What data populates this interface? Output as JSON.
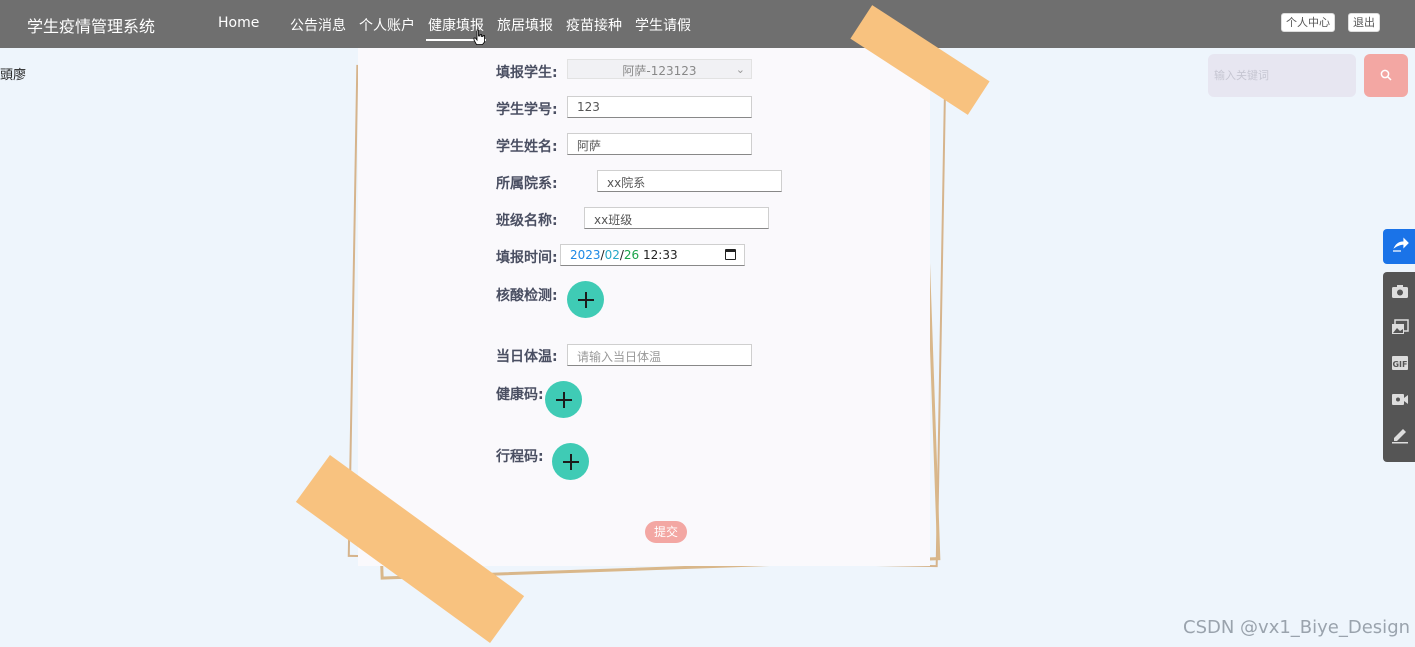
{
  "nav": {
    "brand": "学生疫情管理系统",
    "items": [
      {
        "label": "Home"
      },
      {
        "label": "公告消息"
      },
      {
        "label": "个人账户"
      },
      {
        "label": "健康填报"
      },
      {
        "label": "旅居填报"
      },
      {
        "label": "疫苗接种"
      },
      {
        "label": "学生请假"
      }
    ],
    "active": "健康填报",
    "user_center": "个人中心",
    "logout": "退出"
  },
  "stray_text": "頭廖",
  "search": {
    "placeholder": "输入关键词"
  },
  "form": {
    "student_select": {
      "label": "填报学生:",
      "value": "阿萨-123123"
    },
    "student_id": {
      "label": "学生学号:",
      "value": "123"
    },
    "student_name": {
      "label": "学生姓名:",
      "value": "阿萨"
    },
    "department": {
      "label": "所属院系:",
      "value": "xx院系"
    },
    "class_name": {
      "label": "班级名称:",
      "value": "xx班级"
    },
    "report_time": {
      "label": "填报时间:",
      "year": "2023",
      "month": "02",
      "day": "26",
      "time": "12:33"
    },
    "nucleic_test": {
      "label": "核酸检测:"
    },
    "temperature": {
      "label": "当日体温:",
      "placeholder": "请输入当日体温"
    },
    "health_code": {
      "label": "健康码:"
    },
    "travel_code": {
      "label": "行程码:"
    },
    "submit": "提交"
  },
  "colors": {
    "nav_bg": "#6f6f6f",
    "accent_teal": "#3fcbb5",
    "accent_pink": "#f3a7a3",
    "tape": "#f8c27f",
    "toolbar_blue": "#1a73e8"
  },
  "toolbar_icons": [
    "share-icon",
    "camera-icon",
    "images-icon",
    "gif-icon",
    "video-icon",
    "pen-icon"
  ],
  "watermark": "CSDN @vx1_Biye_Design"
}
